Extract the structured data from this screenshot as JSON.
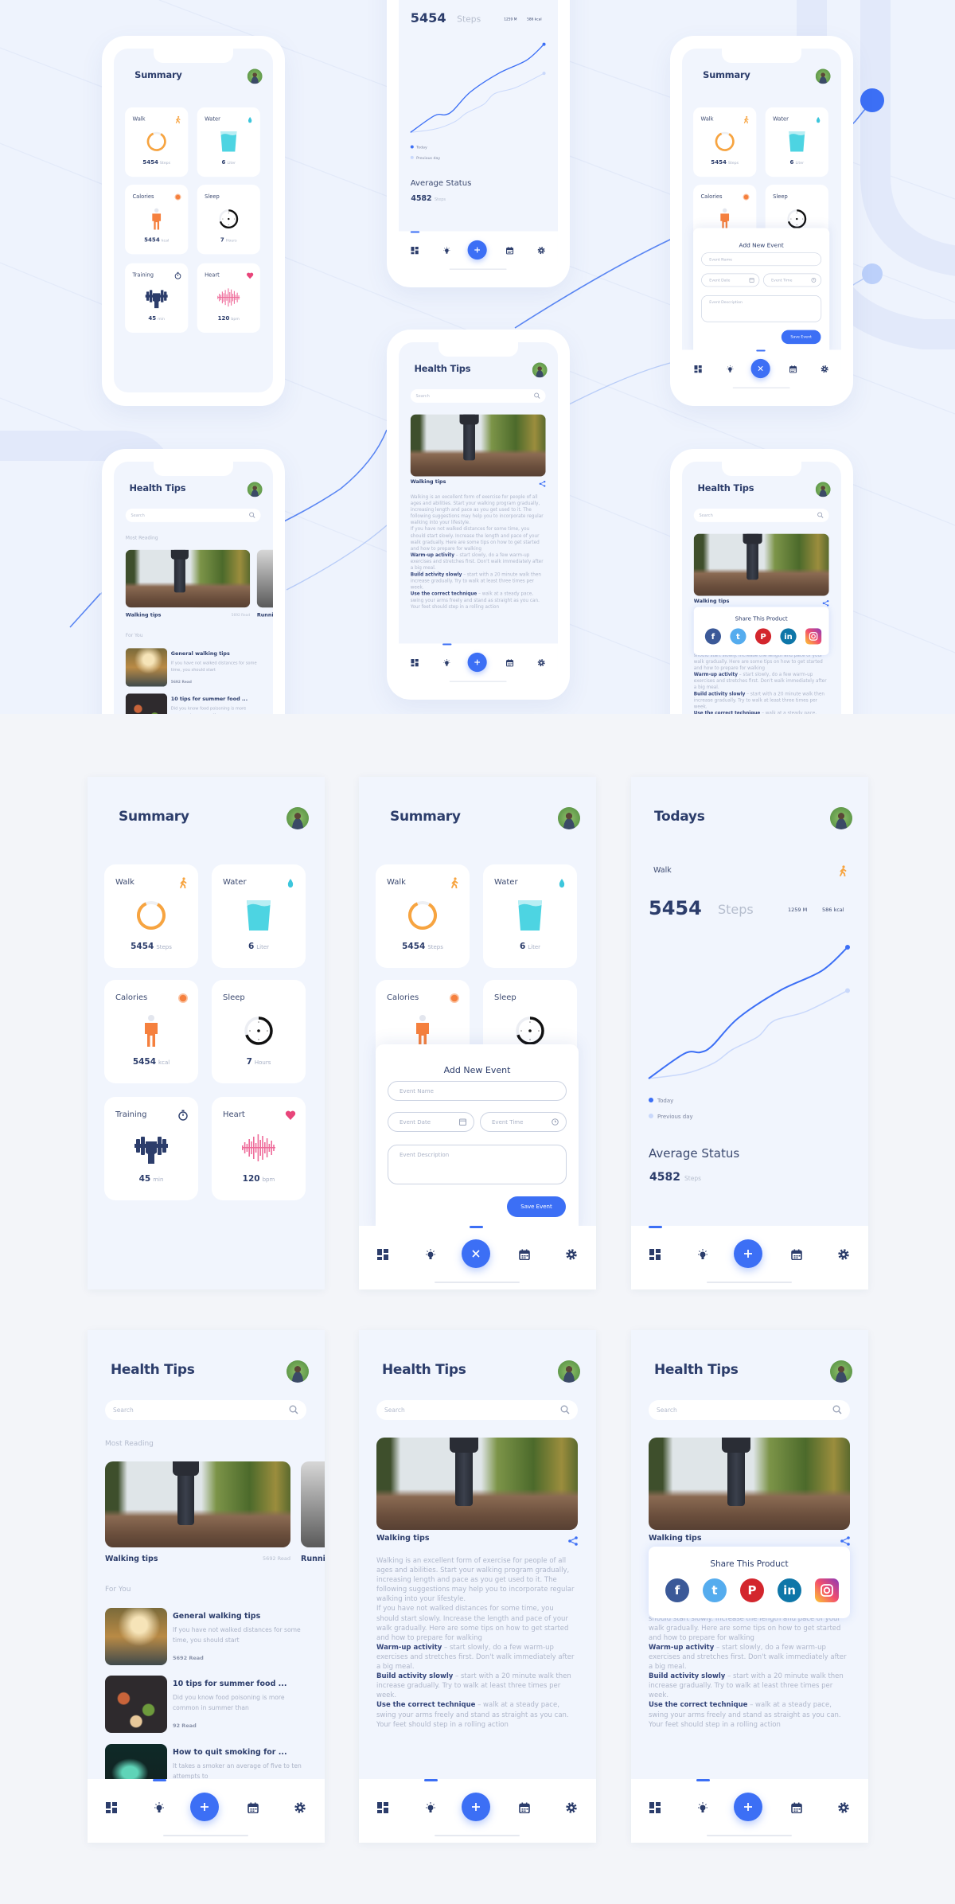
{
  "colors": {
    "accent": "#3c6ff5",
    "navy": "#2c3d6b",
    "walk": "#f7a440",
    "water": "#4dd4e2",
    "calories": "#f5803e",
    "heart": "#e8457a",
    "previous_day": "#c9d8fb"
  },
  "nav": {
    "items": [
      {
        "name": "dashboard",
        "icon": "grid-icon"
      },
      {
        "name": "health-tips",
        "icon": "bulb-icon"
      },
      {
        "name": "add",
        "icon": "plus-icon"
      },
      {
        "name": "calendar",
        "icon": "calendar-icon"
      },
      {
        "name": "settings",
        "icon": "gear-icon"
      }
    ]
  },
  "summary": {
    "title": "Summary",
    "cards": [
      {
        "label": "Walk",
        "icon": "walk-icon",
        "value": "5454",
        "unit": "Steps",
        "progress": 0.85
      },
      {
        "label": "Water",
        "icon": "water-drop-icon",
        "value": "6",
        "unit": "Liter",
        "level": 0.8
      },
      {
        "label": "Calories",
        "icon": "calories-icon",
        "value": "5454",
        "unit": "kcal"
      },
      {
        "label": "Sleep",
        "icon": "moon-icon",
        "value": "7",
        "unit": "Hours",
        "progress": 0.7
      },
      {
        "label": "Training",
        "icon": "stopwatch-icon",
        "value": "45",
        "unit": "min"
      },
      {
        "label": "Heart",
        "icon": "heart-icon",
        "value": "120",
        "unit": "bpm"
      }
    ]
  },
  "event_form": {
    "title": "Add New Event",
    "name_placeholder": "Event Name",
    "date_placeholder": "Event Date",
    "time_placeholder": "Event Time",
    "description_placeholder": "Event Description",
    "save_label": "Save Event"
  },
  "todays": {
    "title": "Todays",
    "activity": "Walk",
    "steps": "5454",
    "steps_unit": "Steps",
    "distance": "1259 M",
    "calories": "586 kcal",
    "average_title": "Average Status",
    "average_value": "4582",
    "average_unit": "Steps"
  },
  "chart_data": {
    "type": "line",
    "title": "",
    "xlabel": "",
    "ylabel": "",
    "grid": false,
    "legend": "bottom-left",
    "series": [
      {
        "name": "Today",
        "color": "#3c6ff5",
        "points": [
          [
            0,
            0
          ],
          [
            18,
            19
          ],
          [
            26,
            20
          ],
          [
            32,
            25
          ],
          [
            45,
            46
          ],
          [
            66,
            67
          ],
          [
            87,
            82
          ],
          [
            100,
            100
          ]
        ]
      },
      {
        "name": "Previous day",
        "color": "#c9d8fb",
        "points": [
          [
            0,
            0
          ],
          [
            19,
            4
          ],
          [
            33,
            12
          ],
          [
            42,
            22
          ],
          [
            55,
            32
          ],
          [
            63,
            44
          ],
          [
            79,
            51
          ],
          [
            100,
            67
          ]
        ]
      }
    ]
  },
  "health_tips": {
    "title": "Health Tips",
    "search_placeholder": "Search",
    "most_reading_label": "Most Reading",
    "featured": [
      {
        "title": "Walking tips",
        "reads": "5692 Read"
      },
      {
        "title": "Running tips"
      }
    ],
    "for_you_label": "For You",
    "items": [
      {
        "title": "General walking tips",
        "description": "If you have not walked distances for some time, you should start",
        "reads": "5692 Read"
      },
      {
        "title": "10 tips for summer food ...",
        "description": "Did you know food poisoning is more common in summer than",
        "reads": "92 Read"
      },
      {
        "title": "How to quit smoking for ...",
        "description": "It takes a smoker an average of five to ten attempts to",
        "reads": ""
      }
    ]
  },
  "article": {
    "title": "Walking tips",
    "paragraphs": [
      {
        "bold": "",
        "text": "Walking is an excellent form of exercise for people of all ages and abilities. Start your walking program gradually, increasing length and pace as you get used to it. The following suggestions may help you to incorporate regular walking into your lifestyle."
      },
      {
        "bold": "",
        "text": "If you have not walked distances for some time, you should start slowly. Increase the length and pace of your walk gradually. Here are some tips on how to get started and how to prepare for walking"
      },
      {
        "bold": "Warm-up activity",
        "text": " – start slowly, do a few warm-up exercises and stretches first. Don't walk immediately after a big meal."
      },
      {
        "bold": "Build activity slowly",
        "text": " – start with a 20 minute walk then increase gradually. Try to walk at least three times per week."
      },
      {
        "bold": "Use the correct technique",
        "text": " – walk at a steady pace, swing your arms freely and stand as straight as you can. Your feet should step in a rolling action"
      }
    ]
  },
  "share": {
    "title": "Share This Product",
    "networks": [
      {
        "name": "facebook",
        "icon": "facebook-icon",
        "color": "#3b5998"
      },
      {
        "name": "twitter",
        "icon": "twitter-icon",
        "color": "#55acee"
      },
      {
        "name": "pinterest",
        "icon": "pinterest-icon",
        "color": "#d3262d"
      },
      {
        "name": "linkedin",
        "icon": "linkedin-icon",
        "color": "#0e76a8"
      },
      {
        "name": "instagram",
        "icon": "instagram-icon",
        "color": "#d6249f"
      }
    ]
  }
}
